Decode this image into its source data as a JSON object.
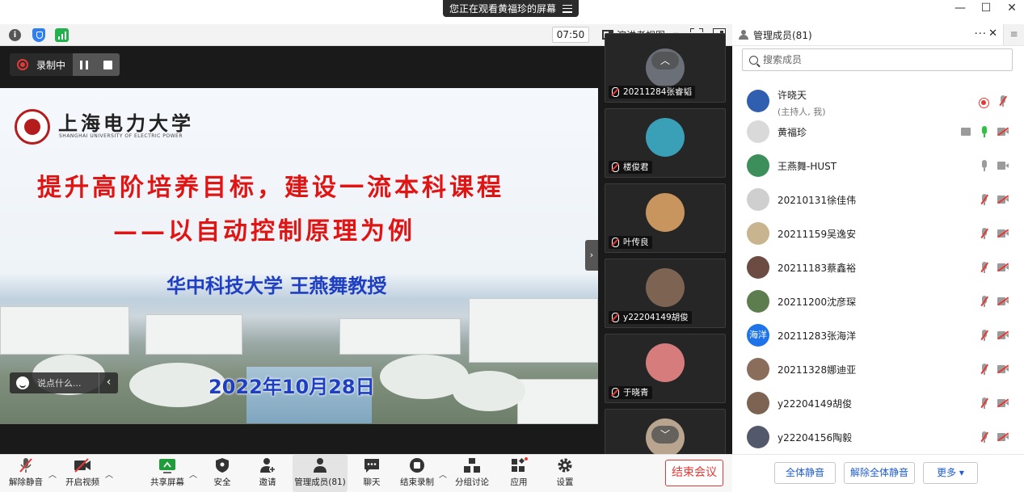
{
  "banner": {
    "text": "您正在观看黄福珍的屏幕"
  },
  "toolbar": {
    "timer": "07:50",
    "view_label": "演讲者视图"
  },
  "recording": {
    "label": "录制中"
  },
  "slide": {
    "university": "上海电力大学",
    "university_en": "SHANGHAI UNIVERSITY OF ELECTRIC POWER",
    "title_line1": "提升高阶培养目标，建设一流本科课程",
    "title_line2": "——以自动控制原理为例",
    "author": "华中科技大学  王燕舞教授",
    "date": "2022年10月28日"
  },
  "chat_input": {
    "placeholder": "说点什么..."
  },
  "thumbnails": [
    {
      "name": "20211284张睿韬",
      "color": "#6a6f78"
    },
    {
      "name": "楼俊君",
      "color": "#3aa0b8"
    },
    {
      "name": "叶传良",
      "color": "#c9955f"
    },
    {
      "name": "y22204149胡俊",
      "color": "#7d6452"
    },
    {
      "name": "于晓青",
      "color": "#d67c7c"
    },
    {
      "name": "",
      "color": "#b9a48f"
    }
  ],
  "bottom_toolbar": {
    "unmute": "解除静音",
    "start_video": "开启视频",
    "share_screen": "共享屏幕",
    "security": "安全",
    "invite": "邀请",
    "participants": "管理成员(81)",
    "chat": "聊天",
    "end_recording": "结束录制",
    "breakout": "分组讨论",
    "apps": "应用",
    "settings": "设置",
    "end_meeting": "结束会议"
  },
  "panel": {
    "title": "管理成员(81)",
    "search_placeholder": "搜索成员",
    "members": [
      {
        "name": "许晓天",
        "role": "(主持人, 我)",
        "avatar_color": "#2f5fae",
        "avatar_text": "",
        "mic": "muted",
        "cam": "none",
        "recording": true
      },
      {
        "name": "黄福珍",
        "role": "",
        "avatar_color": "#d9d9d9",
        "avatar_text": "",
        "mic": "on",
        "cam": "off",
        "sharing": true
      },
      {
        "name": "王燕舞-HUST",
        "role": "",
        "avatar_color": "#3c8f5a",
        "avatar_text": "",
        "mic": "idle",
        "cam": "idle"
      },
      {
        "name": "20210131徐佳伟",
        "role": "",
        "avatar_color": "#cfcfcf",
        "avatar_text": "",
        "mic": "muted",
        "cam": "off"
      },
      {
        "name": "20211159吴逸安",
        "role": "",
        "avatar_color": "#c8b48e",
        "avatar_text": "",
        "mic": "muted",
        "cam": "off"
      },
      {
        "name": "20211183蔡鑫裕",
        "role": "",
        "avatar_color": "#6b4b42",
        "avatar_text": "",
        "mic": "muted",
        "cam": "off"
      },
      {
        "name": "20211200沈彦琛",
        "role": "",
        "avatar_color": "#5d7d4e",
        "avatar_text": "",
        "mic": "muted",
        "cam": "off"
      },
      {
        "name": "20211283张海洋",
        "role": "",
        "avatar_color": "#1e73e8",
        "avatar_text": "海洋",
        "mic": "muted",
        "cam": "off"
      },
      {
        "name": "20211328娜迪亚",
        "role": "",
        "avatar_color": "#8a6d5a",
        "avatar_text": "",
        "mic": "muted",
        "cam": "off"
      },
      {
        "name": "y22204149胡俊",
        "role": "",
        "avatar_color": "#7d6452",
        "avatar_text": "",
        "mic": "muted",
        "cam": "off"
      },
      {
        "name": "y22204156陶毅",
        "role": "",
        "avatar_color": "#53596a",
        "avatar_text": "",
        "mic": "muted",
        "cam": "off"
      }
    ],
    "mute_all": "全体静音",
    "unmute_all": "解除全体静音",
    "more": "更多 ▾"
  }
}
